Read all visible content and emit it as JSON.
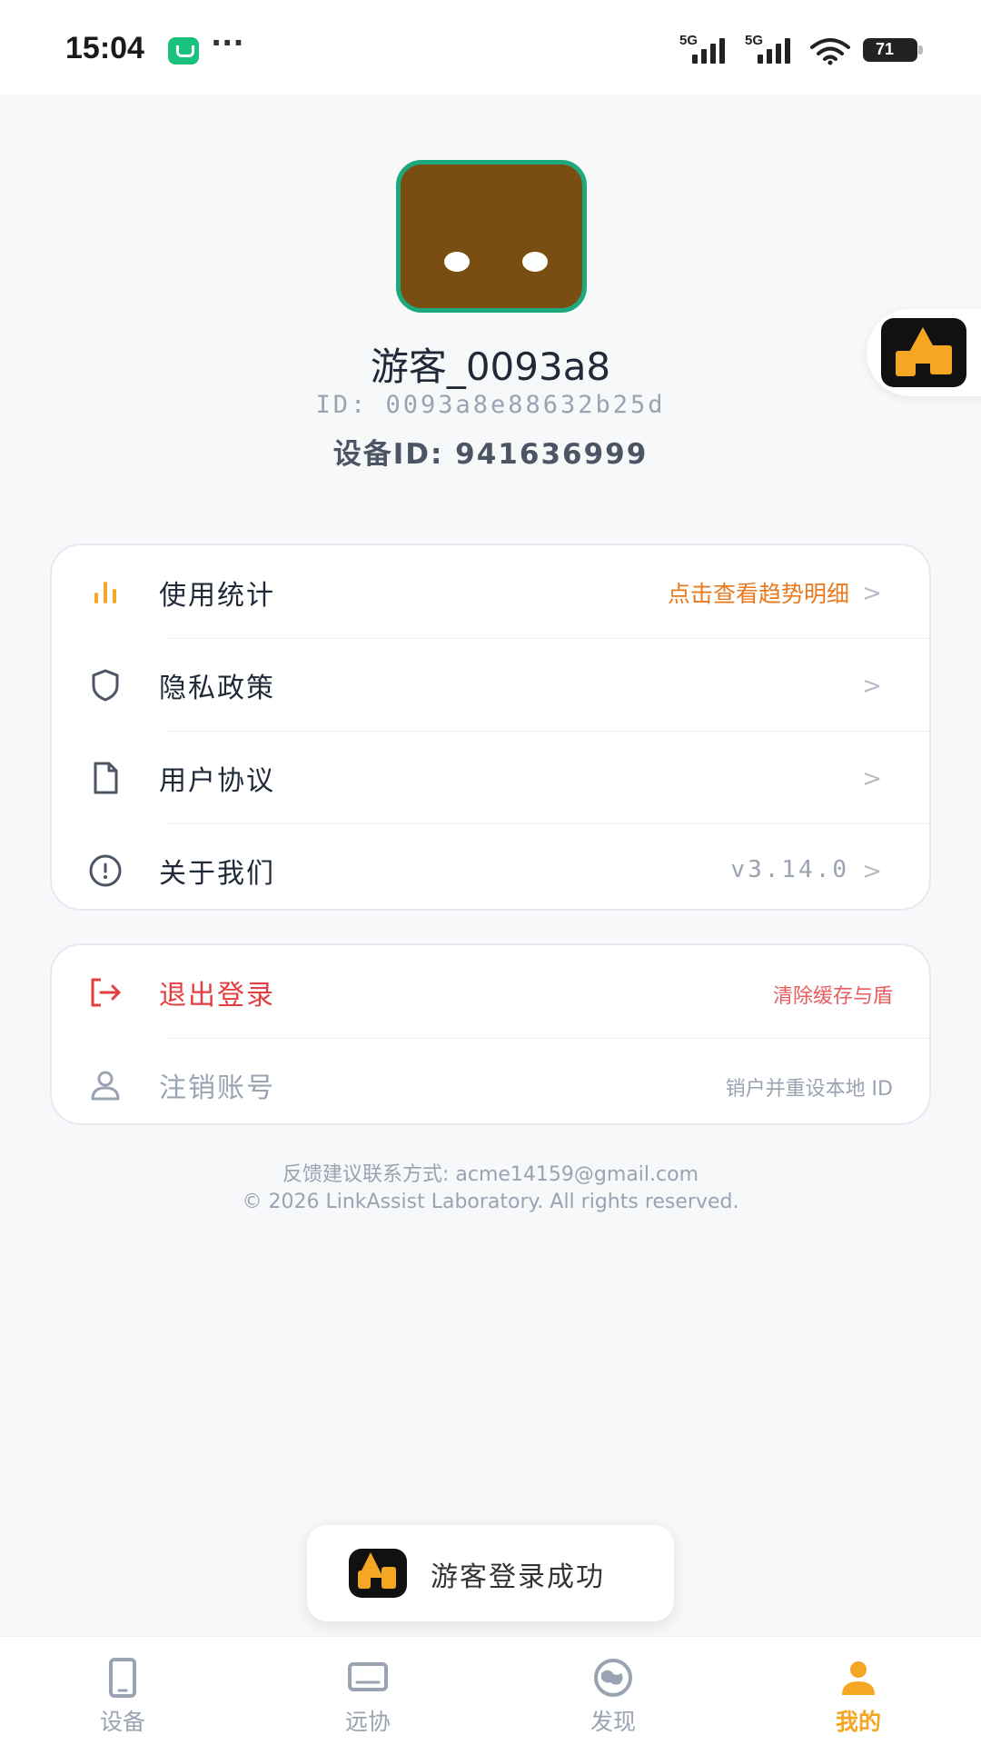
{
  "status_bar": {
    "time": "15:04",
    "dots": "···",
    "net1": "5G",
    "net2": "5G",
    "battery": "71"
  },
  "profile": {
    "name": "游客_0093a8",
    "id_text": "ID: 0093a8e88632b25d",
    "device_id_text": "设备ID: 941636999"
  },
  "menu": {
    "items": [
      {
        "label": "使用统计",
        "value": "点击查看趋势明细",
        "icon": "bar-chart-icon"
      },
      {
        "label": "隐私政策",
        "value": "",
        "icon": "shield-icon"
      },
      {
        "label": "用户协议",
        "value": "",
        "icon": "document-icon"
      },
      {
        "label": "关于我们",
        "value": "v3.14.0",
        "icon": "info-icon"
      }
    ],
    "chevron": ">"
  },
  "account": {
    "logout_label": "退出登录",
    "logout_sub": "清除缓存与盾",
    "deregister_label": "注销账号",
    "deregister_sub": "销户并重设本地 ID"
  },
  "footer": {
    "contact": "反馈建议联系方式: acme14159@gmail.com",
    "copyright": "© 2026 LinkAssist Laboratory. All rights reserved."
  },
  "toast": {
    "text": "游客登录成功"
  },
  "bottom_nav": {
    "items": [
      {
        "label": "设备",
        "icon": "tablet-icon"
      },
      {
        "label": "远协",
        "icon": "monitor-icon"
      },
      {
        "label": "发现",
        "icon": "globe-icon"
      },
      {
        "label": "我的",
        "icon": "person-icon"
      }
    ],
    "active_index": 3
  },
  "colors": {
    "accent": "#f5a623",
    "orange_text": "#e8791f",
    "danger": "#e53e3e",
    "avatar_bg": "#7a4d13",
    "avatar_border": "#1ea97c"
  }
}
